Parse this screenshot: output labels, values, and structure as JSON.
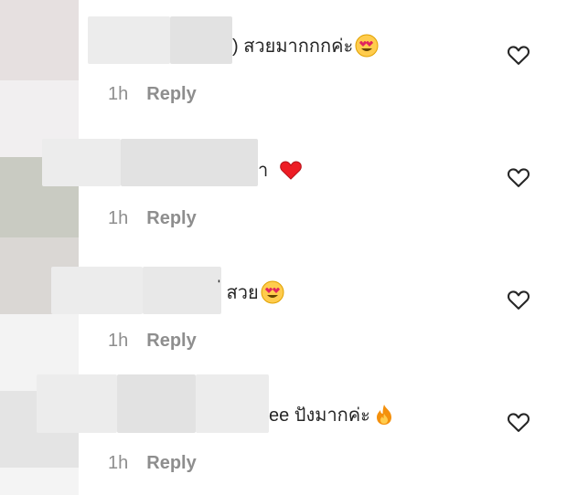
{
  "comments": [
    {
      "text": ") สวยมากกกค่ะ",
      "emoji": "heart-eyes",
      "time": "1h",
      "reply": "Reply"
    },
    {
      "text": "า",
      "emoji": "red-heart",
      "time": "1h",
      "reply": "Reply"
    },
    {
      "text": "่ สวย",
      "emoji": "heart-eyes",
      "time": "1h",
      "reply": "Reply"
    },
    {
      "text": "ee ปังมากค่ะ",
      "emoji": "fire",
      "time": "1h",
      "reply": "Reply"
    }
  ],
  "colors": {
    "text": "#262626",
    "meta": "#8e8e8e",
    "heart": "#ed1c24"
  }
}
